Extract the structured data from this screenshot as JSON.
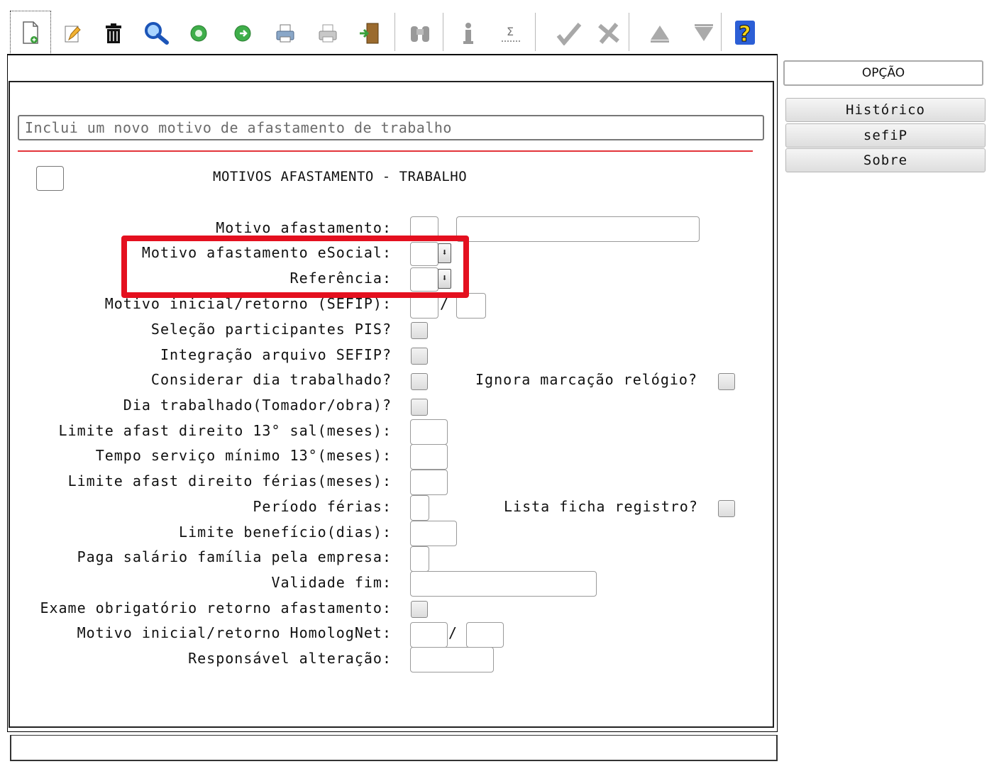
{
  "colors": {
    "highlight_border": "#e4101f",
    "separator_red": "#e3343a",
    "window_border": "#222222"
  },
  "toolbar": {
    "icons": [
      "new-document-icon",
      "edit-pencil-icon",
      "trash-icon",
      "search-magnifier-icon",
      "previous-record-icon",
      "next-record-icon",
      "print-icon",
      "print-setup-icon",
      "exit-door-icon",
      "binoculars-icon",
      "info-icon",
      "sum-icon",
      "confirm-check-icon",
      "cancel-x-icon",
      "first-record-icon",
      "last-record-icon",
      "help-icon"
    ]
  },
  "hint": {
    "text": "Inclui um novo motivo de afastamento de trabalho"
  },
  "form": {
    "title": "MOTIVOS AFASTAMENTO - TRABALHO",
    "labels": {
      "motivo_afastamento": "Motivo afastamento:",
      "motivo_esocial": "Motivo afastamento eSocial:",
      "referencia": "Referência:",
      "motivo_sefip": "Motivo inicial/retorno (SEFIP):",
      "selecao_pis": "Seleção participantes PIS?",
      "integracao_sefip": "Integração arquivo SEFIP?",
      "considerar_dia": "Considerar dia trabalhado?",
      "ignora_marcacao": "Ignora marcação relógio?",
      "dia_trabalhado": "Dia trabalhado(Tomador/obra)?",
      "limite_13": "Limite afast direito 13° sal(meses):",
      "tempo_servico": "Tempo serviço mínimo 13°(meses):",
      "limite_ferias": "Limite afast direito férias(meses):",
      "periodo_ferias": "Período férias:",
      "lista_ficha": "Lista ficha registro?",
      "limite_beneficio": "Limite benefício(dias):",
      "paga_salario": "Paga salário família pela empresa:",
      "validade_fim": "Validade fim:",
      "exame_obrigatorio": "Exame obrigatório retorno afastamento:",
      "motivo_homolognet": "Motivo inicial/retorno HomologNet:",
      "responsavel": "Responsável alteração:"
    },
    "separator": "/"
  },
  "side_panel": {
    "header": "OPÇÃO",
    "buttons": [
      "Histórico",
      "sefiP",
      "Sobre"
    ]
  }
}
